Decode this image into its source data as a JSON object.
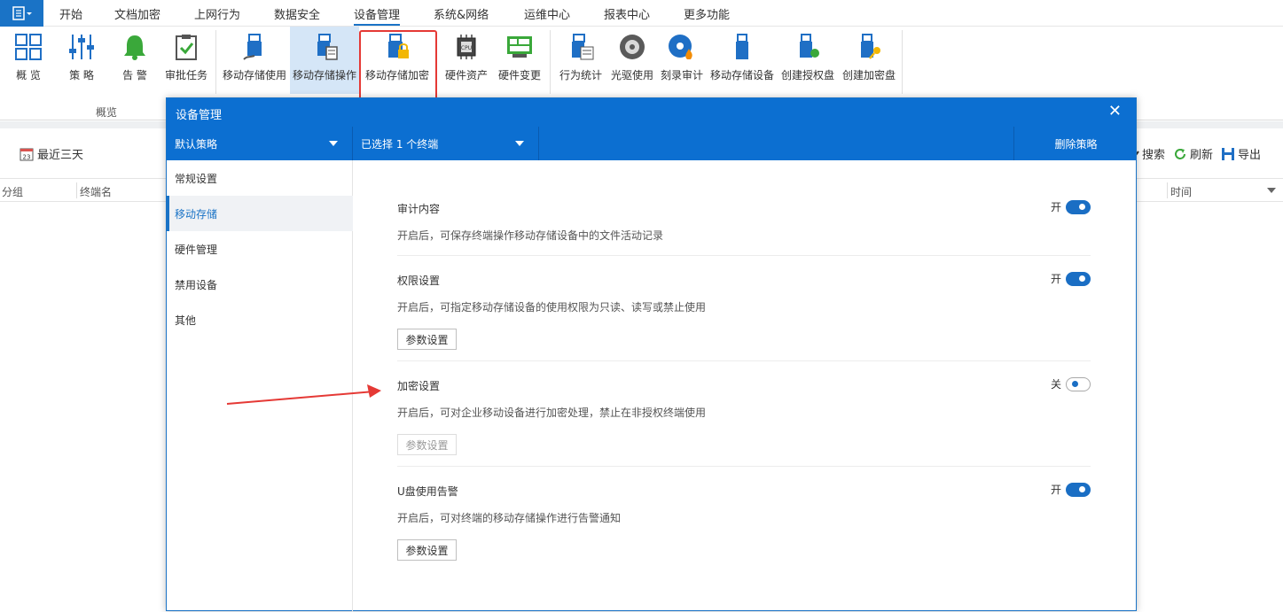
{
  "menubar": {
    "items": [
      "开始",
      "文档加密",
      "上网行为",
      "数据安全",
      "设备管理",
      "系统&网络",
      "运维中心",
      "报表中心",
      "更多功能"
    ],
    "active_index": 4
  },
  "ribbon": {
    "buttons": [
      {
        "label": "概 览",
        "icon": "overview-grid-icon"
      },
      {
        "label": "策 略",
        "icon": "policy-sliders-icon"
      },
      {
        "label": "告 警",
        "icon": "alarm-bell-icon"
      },
      {
        "label": "审批任务",
        "icon": "approval-clipboard-icon"
      },
      {
        "label": "移动存储使用",
        "icon": "usb-usage-icon"
      },
      {
        "label": "移动存储操作",
        "icon": "usb-operation-icon"
      },
      {
        "label": "移动存储加密",
        "icon": "usb-encrypt-icon"
      },
      {
        "label": "硬件资产",
        "icon": "cpu-icon"
      },
      {
        "label": "硬件变更",
        "icon": "hardware-change-icon"
      },
      {
        "label": "行为统计",
        "icon": "behavior-stats-icon"
      },
      {
        "label": "光驱使用",
        "icon": "cd-drive-icon"
      },
      {
        "label": "刻录审计",
        "icon": "burn-audit-icon"
      },
      {
        "label": "移动存储设备",
        "icon": "usb-device-icon"
      },
      {
        "label": "创建授权盘",
        "icon": "create-auth-disk-icon"
      },
      {
        "label": "创建加密盘",
        "icon": "create-encrypt-disk-icon"
      }
    ],
    "group_label": "概览"
  },
  "toolbar": {
    "recent": "最近三天",
    "search": "搜索",
    "refresh": "刷新",
    "export": "导出"
  },
  "grid": {
    "columns": [
      "分组",
      "终端名",
      "时间"
    ]
  },
  "dialog": {
    "title": "设备管理",
    "policy_select": "默认策略",
    "terminal_select": "已选择 1 个终端",
    "delete_button": "删除策略",
    "side_items": [
      "常规设置",
      "移动存储",
      "硬件管理",
      "禁用设备",
      "其他"
    ],
    "active_side_index": 1,
    "sections": [
      {
        "title": "审计内容",
        "desc": "开启后，可保存终端操作移动存储设备中的文件活动记录",
        "state": "开",
        "on": true,
        "param": null
      },
      {
        "title": "权限设置",
        "desc": "开启后，可指定移动存储设备的使用权限为只读、读写或禁止使用",
        "state": "开",
        "on": true,
        "param": "参数设置"
      },
      {
        "title": "加密设置",
        "desc": "开启后，可对企业移动设备进行加密处理，禁止在非授权终端使用",
        "state": "关",
        "on": false,
        "param": "参数设置"
      },
      {
        "title": "U盘使用告警",
        "desc": "开启后，可对终端的移动存储操作进行告警通知",
        "state": "开",
        "on": true,
        "param": "参数设置"
      }
    ]
  },
  "colors": {
    "accent": "#0c6fd1",
    "highlight_box": "#e53935",
    "arrow": "#e53935"
  }
}
